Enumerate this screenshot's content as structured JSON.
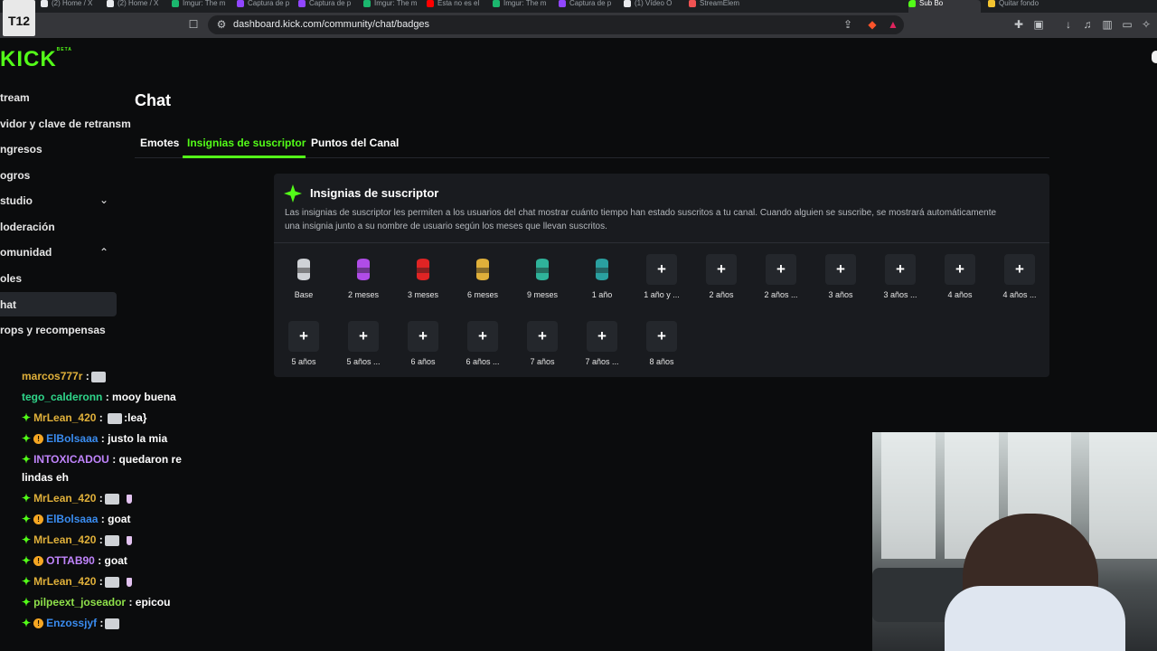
{
  "browser": {
    "tabs": [
      {
        "label": "(2) Home / X",
        "color": "#e8eaed"
      },
      {
        "label": "(2) Home / X",
        "color": "#e8eaed"
      },
      {
        "label": "Imgur: The m",
        "color": "#1bb76e"
      },
      {
        "label": "Captura de p",
        "color": "#9146ff"
      },
      {
        "label": "Captura de p",
        "color": "#9146ff"
      },
      {
        "label": "Imgur: The m",
        "color": "#1bb76e"
      },
      {
        "label": "Esta no es el",
        "color": "#ff0000"
      },
      {
        "label": "Imgur: The m",
        "color": "#1bb76e"
      },
      {
        "label": "Captura de p",
        "color": "#9146ff"
      },
      {
        "label": "(1) Vídeo O",
        "color": "#e8eaed"
      },
      {
        "label": "StreamElem",
        "color": "#f05252"
      },
      {
        "label": "Sub Bo",
        "color": "#53fc18"
      },
      {
        "label": "Quitar fondo",
        "color": "#f4c430"
      }
    ],
    "url": "dashboard.kick.com/community/chat/badges"
  },
  "app": {
    "logo": "KICK",
    "logo_beta": "BETA"
  },
  "sidebar": {
    "items": [
      {
        "label": "tream"
      },
      {
        "label": "vidor y clave de retransm"
      },
      {
        "label": "ngresos"
      },
      {
        "label": "ogros"
      },
      {
        "label": "studio"
      },
      {
        "label": "loderación"
      },
      {
        "label": "omunidad"
      },
      {
        "label": "oles"
      },
      {
        "label": "hat"
      },
      {
        "label": "rops y recompensas"
      }
    ],
    "active_index": 8
  },
  "main": {
    "title": "Chat",
    "tabs": [
      {
        "label": "Emotes"
      },
      {
        "label": "Insignias de suscriptor"
      },
      {
        "label": "Puntos del Canal"
      }
    ],
    "active_tab": 1
  },
  "card": {
    "title": "Insignias de suscriptor",
    "description": "Las insignias de suscriptor les permiten a los usuarios del chat mostrar cuánto tiempo han estado suscritos a tu canal. Cuando alguien se suscribe, se mostrará automáticamente una insignia junto a su nombre de usuario según los meses que llevan suscritos.",
    "badges": [
      {
        "label": "Base",
        "icon": "badge-icon",
        "color": "#cfd2d6"
      },
      {
        "label": "2 meses",
        "icon": "badge-icon",
        "color": "#b04ce8"
      },
      {
        "label": "3 meses",
        "icon": "badge-icon",
        "color": "#e02424"
      },
      {
        "label": "6 meses",
        "icon": "badge-icon",
        "color": "#e0b03a"
      },
      {
        "label": "9 meses",
        "icon": "badge-icon",
        "color": "#2fb39a"
      },
      {
        "label": "1 año",
        "icon": "badge-icon",
        "color": "#2aa0a0"
      },
      {
        "label": "1 año y ...",
        "icon": "plus-icon"
      },
      {
        "label": "2 años",
        "icon": "plus-icon"
      },
      {
        "label": "2 años ...",
        "icon": "plus-icon"
      },
      {
        "label": "3 años",
        "icon": "plus-icon"
      },
      {
        "label": "3 años ...",
        "icon": "plus-icon"
      },
      {
        "label": "4 años",
        "icon": "plus-icon"
      },
      {
        "label": "4 años ...",
        "icon": "plus-icon"
      },
      {
        "label": "5 años",
        "icon": "plus-icon"
      },
      {
        "label": "5 años ...",
        "icon": "plus-icon"
      },
      {
        "label": "6 años",
        "icon": "plus-icon"
      },
      {
        "label": "6 años ...",
        "icon": "plus-icon"
      },
      {
        "label": "7 años",
        "icon": "plus-icon"
      },
      {
        "label": "7 años ...",
        "icon": "plus-icon"
      },
      {
        "label": "8 años",
        "icon": "plus-icon"
      }
    ]
  },
  "chat": {
    "messages": [
      {
        "user": "marcos777r",
        "color": "#e0b03a",
        "text": ":",
        "emote": true,
        "prefix": ""
      },
      {
        "user": "tego_calderonn",
        "color": "#2fd68a",
        "text": ": mooy buena",
        "emote": false,
        "prefix": ""
      },
      {
        "user": "MrLean_420",
        "color": "#e0b03a",
        "text": ": ",
        "emote": true,
        "suffix": ":lea}",
        "prefix": "dia"
      },
      {
        "user": "ElBolsaaa",
        "color": "#3a8cf0",
        "text": ": justo la mia",
        "emote": false,
        "prefix": "dia-coin"
      },
      {
        "user": "INTOXICADOU",
        "color": "#c084fc",
        "text": ": quedaron re",
        "emote": false,
        "prefix": "dia"
      },
      {
        "user": "",
        "color": "#ffffff",
        "text": "lindas eh",
        "emote": false,
        "prefix": ""
      },
      {
        "user": "MrLean_420",
        "color": "#e0b03a",
        "text": ":",
        "emote": true,
        "cup": true,
        "prefix": "dia"
      },
      {
        "user": "ElBolsaaa",
        "color": "#3a8cf0",
        "text": ": goat",
        "emote": false,
        "prefix": "dia-coin"
      },
      {
        "user": "MrLean_420",
        "color": "#e0b03a",
        "text": ":",
        "emote": true,
        "cup": true,
        "prefix": "dia"
      },
      {
        "user": "OTTAB90",
        "color": "#c084fc",
        "text": ": goat",
        "emote": false,
        "prefix": "dia-coin"
      },
      {
        "user": "MrLean_420",
        "color": "#e0b03a",
        "text": ":",
        "emote": true,
        "cup": true,
        "prefix": "dia"
      },
      {
        "user": "pilpeext_joseador",
        "color": "#8ee04a",
        "text": ": epicou",
        "emote": false,
        "prefix": "dia"
      },
      {
        "user": "Enzossjyf",
        "color": "#3a8cf0",
        "text": ":",
        "emote": true,
        "prefix": "dia-coin"
      }
    ]
  },
  "overlay": {
    "streamer_logo": "T12"
  }
}
